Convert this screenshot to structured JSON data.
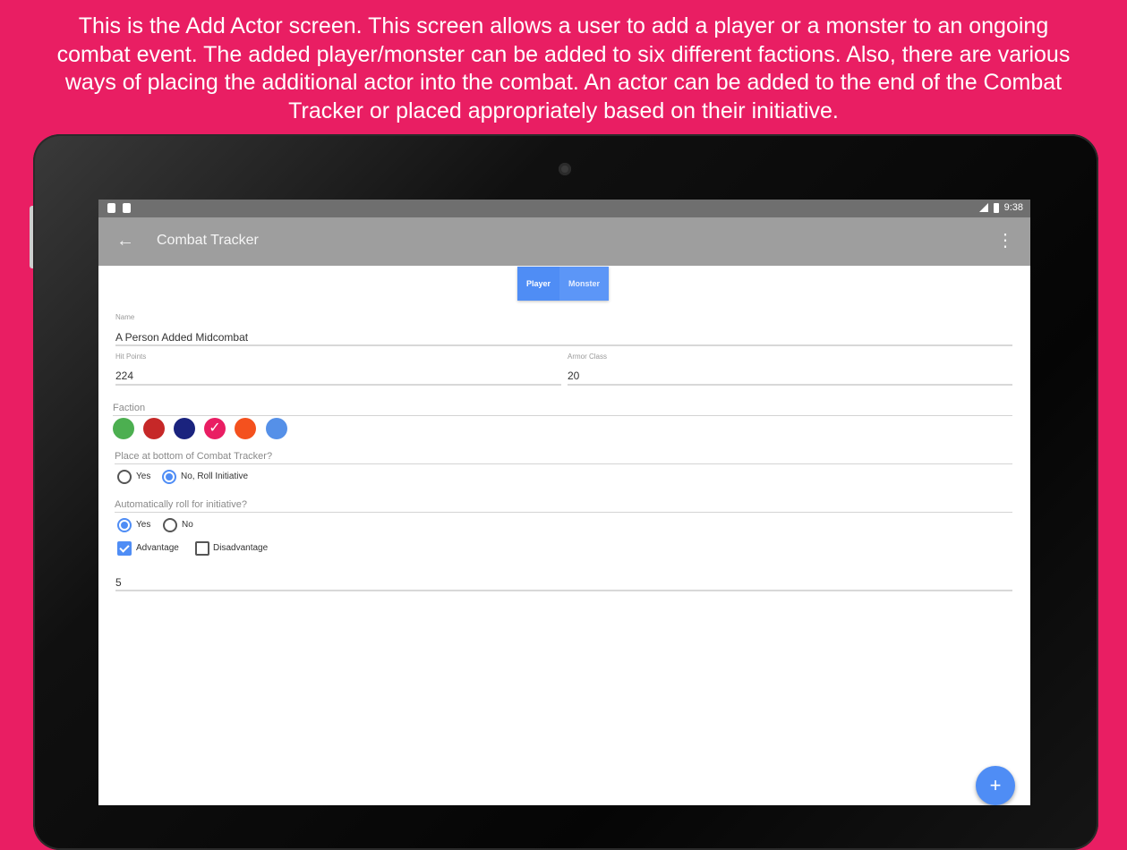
{
  "caption": {
    "lines": [
      "This is the Add Actor screen. This screen allows a user to add a player or a monster to an ongoing",
      "combat event. The added player/monster can be added to six different factions. Also, there are various",
      "ways of placing the additional actor into the combat. An actor can be added to the end of the Combat",
      "Tracker or placed appropriately based on their initiative."
    ]
  },
  "statusbar": {
    "time": "9:38"
  },
  "toolbar": {
    "back_icon": "arrow-back-icon",
    "title": "Combat Tracker",
    "overflow_icon": "more-vert-icon"
  },
  "actor_type": {
    "options": [
      "Player",
      "Monster"
    ],
    "selected": "Player"
  },
  "form": {
    "name_label": "Name",
    "name_value": "A Person Added Midcombat",
    "hp_label": "Hit Points",
    "hp_value": "224",
    "ac_label": "Armor Class",
    "ac_value": "20",
    "faction_label": "Faction",
    "faction_colors": [
      "#4caf50",
      "#c62828",
      "#1a237e",
      "#e91e63",
      "#f4511e",
      "#5590e8"
    ],
    "faction_selected": 3,
    "placement_label": "Place at bottom of Combat Tracker?",
    "placement_options": [
      "Yes",
      "No, Roll Initiative"
    ],
    "placement_selected": "No, Roll Initiative",
    "auto_roll_label": "Automatically roll for initiative?",
    "auto_roll_options": [
      "Yes",
      "No"
    ],
    "auto_roll_selected": "Yes",
    "advantage_label": "Advantage",
    "advantage_checked": true,
    "disadvantage_label": "Disadvantage",
    "disadvantage_checked": false,
    "initiative_bonus_value": "5"
  },
  "fab": {
    "icon": "plus-icon",
    "label": "+"
  },
  "colors": {
    "background": "#e91e63",
    "toolbar": "#9e9e9e",
    "accent": "#4f8df5"
  }
}
